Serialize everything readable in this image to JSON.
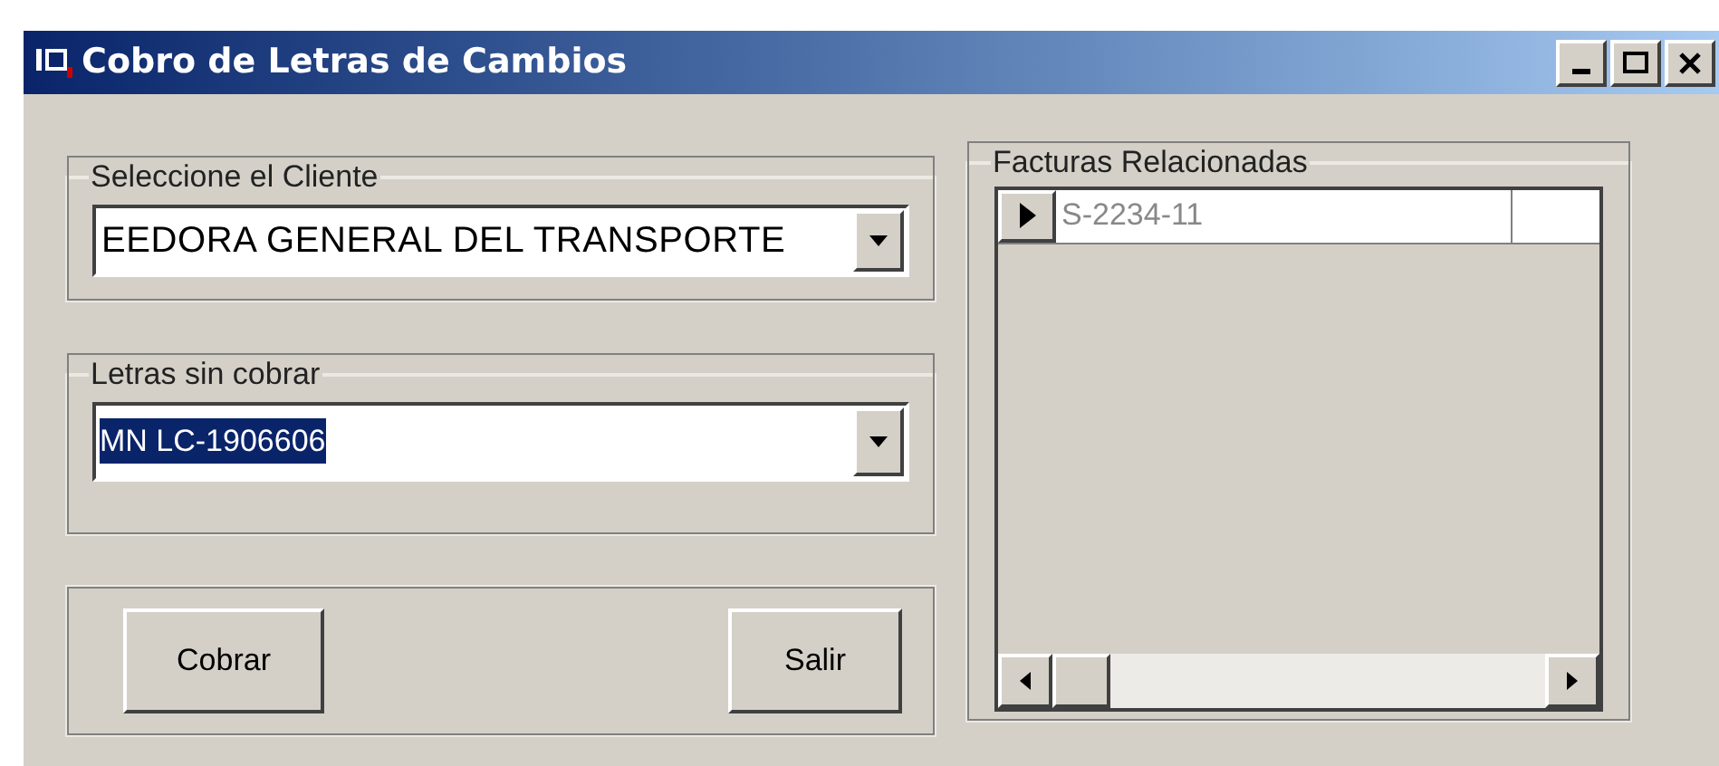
{
  "window": {
    "title": "Cobro de Letras de Cambios"
  },
  "client_group": {
    "label": "Seleccione el Cliente",
    "value": "EEDORA GENERAL DEL TRANSPORTE"
  },
  "letters_group": {
    "label": "Letras sin cobrar",
    "value": "MN LC-1906606",
    "text_selected": true
  },
  "buttons": [
    {
      "label": "Cobrar"
    },
    {
      "label": "Salir"
    }
  ],
  "invoices_group": {
    "label": "Facturas Relacionadas",
    "rows": [
      {
        "current": true,
        "cells": [
          "S-2234-11"
        ]
      }
    ]
  }
}
